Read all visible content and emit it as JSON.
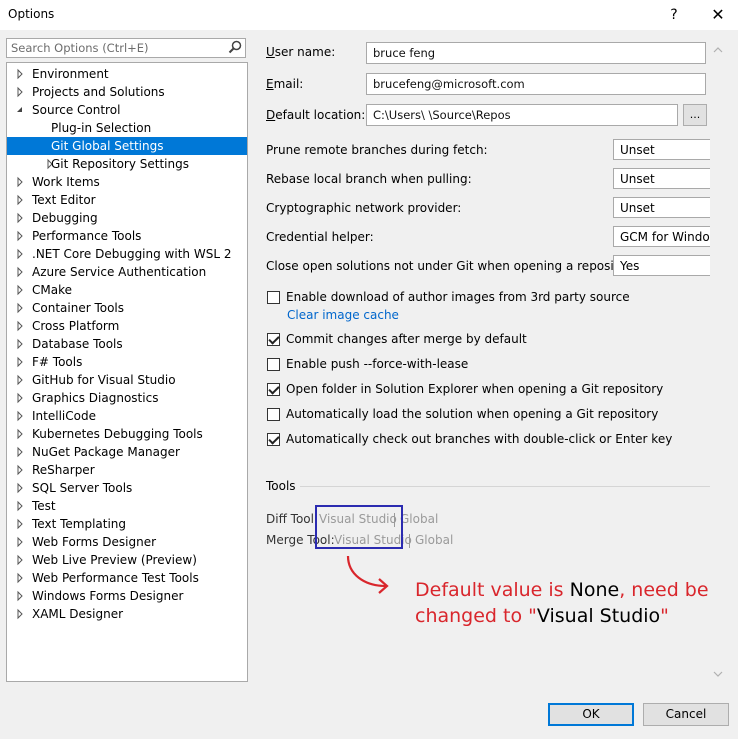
{
  "window": {
    "title": "Options",
    "help_glyph": "?",
    "close_glyph": "✕"
  },
  "search": {
    "placeholder": "Search Options (Ctrl+E)"
  },
  "tree": [
    {
      "label": "Environment",
      "level": 0,
      "arrow": "right"
    },
    {
      "label": "Projects and Solutions",
      "level": 0,
      "arrow": "right"
    },
    {
      "label": "Source Control",
      "level": 0,
      "arrow": "down"
    },
    {
      "label": "Plug-in Selection",
      "level": 1,
      "arrow": "none"
    },
    {
      "label": "Git Global Settings",
      "level": 1,
      "arrow": "none",
      "selected": true
    },
    {
      "label": "Git Repository Settings",
      "level": 1,
      "arrow": "right"
    },
    {
      "label": "Work Items",
      "level": 0,
      "arrow": "right"
    },
    {
      "label": "Text Editor",
      "level": 0,
      "arrow": "right"
    },
    {
      "label": "Debugging",
      "level": 0,
      "arrow": "right"
    },
    {
      "label": "Performance Tools",
      "level": 0,
      "arrow": "right"
    },
    {
      "label": ".NET Core Debugging with WSL 2",
      "level": 0,
      "arrow": "right"
    },
    {
      "label": "Azure Service Authentication",
      "level": 0,
      "arrow": "right"
    },
    {
      "label": "CMake",
      "level": 0,
      "arrow": "right"
    },
    {
      "label": "Container Tools",
      "level": 0,
      "arrow": "right"
    },
    {
      "label": "Cross Platform",
      "level": 0,
      "arrow": "right"
    },
    {
      "label": "Database Tools",
      "level": 0,
      "arrow": "right"
    },
    {
      "label": "F# Tools",
      "level": 0,
      "arrow": "right"
    },
    {
      "label": "GitHub for Visual Studio",
      "level": 0,
      "arrow": "right"
    },
    {
      "label": "Graphics Diagnostics",
      "level": 0,
      "arrow": "right"
    },
    {
      "label": "IntelliCode",
      "level": 0,
      "arrow": "right"
    },
    {
      "label": "Kubernetes Debugging Tools",
      "level": 0,
      "arrow": "right"
    },
    {
      "label": "NuGet Package Manager",
      "level": 0,
      "arrow": "right"
    },
    {
      "label": "ReSharper",
      "level": 0,
      "arrow": "right"
    },
    {
      "label": "SQL Server Tools",
      "level": 0,
      "arrow": "right"
    },
    {
      "label": "Test",
      "level": 0,
      "arrow": "right"
    },
    {
      "label": "Text Templating",
      "level": 0,
      "arrow": "right"
    },
    {
      "label": "Web Forms Designer",
      "level": 0,
      "arrow": "right"
    },
    {
      "label": "Web Live Preview (Preview)",
      "level": 0,
      "arrow": "right"
    },
    {
      "label": "Web Performance Test Tools",
      "level": 0,
      "arrow": "right"
    },
    {
      "label": "Windows Forms Designer",
      "level": 0,
      "arrow": "right"
    },
    {
      "label": "XAML Designer",
      "level": 0,
      "arrow": "right"
    }
  ],
  "form": {
    "user_name": {
      "label": "User name:",
      "value": "bruce feng"
    },
    "email": {
      "label": "Email:",
      "value": "brucefeng@microsoft.com"
    },
    "default_location": {
      "label": "Default location:",
      "value": "C:\\Users\\      \\Source\\Repos",
      "browse": "..."
    },
    "prune": {
      "label": "Prune remote branches during fetch:",
      "value": "Unset"
    },
    "rebase": {
      "label": "Rebase local branch when pulling:",
      "value": "Unset"
    },
    "crypto": {
      "label": "Cryptographic network provider:",
      "value": "Unset"
    },
    "credential": {
      "label": "Credential helper:",
      "value": "GCM for Windows"
    },
    "close_open": {
      "label": "Close open solutions not under Git when opening a repository:",
      "value": "Yes"
    }
  },
  "checkboxes": [
    {
      "label": "Enable download of author images from 3rd party source",
      "checked": false
    },
    {
      "label": "Commit changes after merge by default",
      "checked": true
    },
    {
      "label": "Enable push --force-with-lease",
      "checked": false
    },
    {
      "label": "Open folder in Solution Explorer when opening a Git repository",
      "checked": true
    },
    {
      "label": "Automatically load the solution when opening a Git repository",
      "checked": false
    },
    {
      "label": "Automatically check out branches with double-click or Enter key",
      "checked": true
    }
  ],
  "clear_cache_link": "Clear image cache",
  "tools": {
    "heading": "Tools",
    "diff": {
      "label": "Diff Tool:",
      "opt1": "Visual Studio",
      "opt2": "Global"
    },
    "merge": {
      "label": "Merge Tool:",
      "opt1": "Visual Studio",
      "opt2": "Global"
    }
  },
  "annotation": {
    "part1": "Default value is ",
    "part2": "None",
    "part3": ", need be",
    "part4": "changed to \"",
    "part5": "Visual Studio",
    "part6": "\""
  },
  "buttons": {
    "ok": "OK",
    "cancel": "Cancel"
  },
  "colors": {
    "selection": "#0078d7",
    "annotation": "#d9262c",
    "highlight_box": "#2b2bb0",
    "link": "#0066cc"
  }
}
